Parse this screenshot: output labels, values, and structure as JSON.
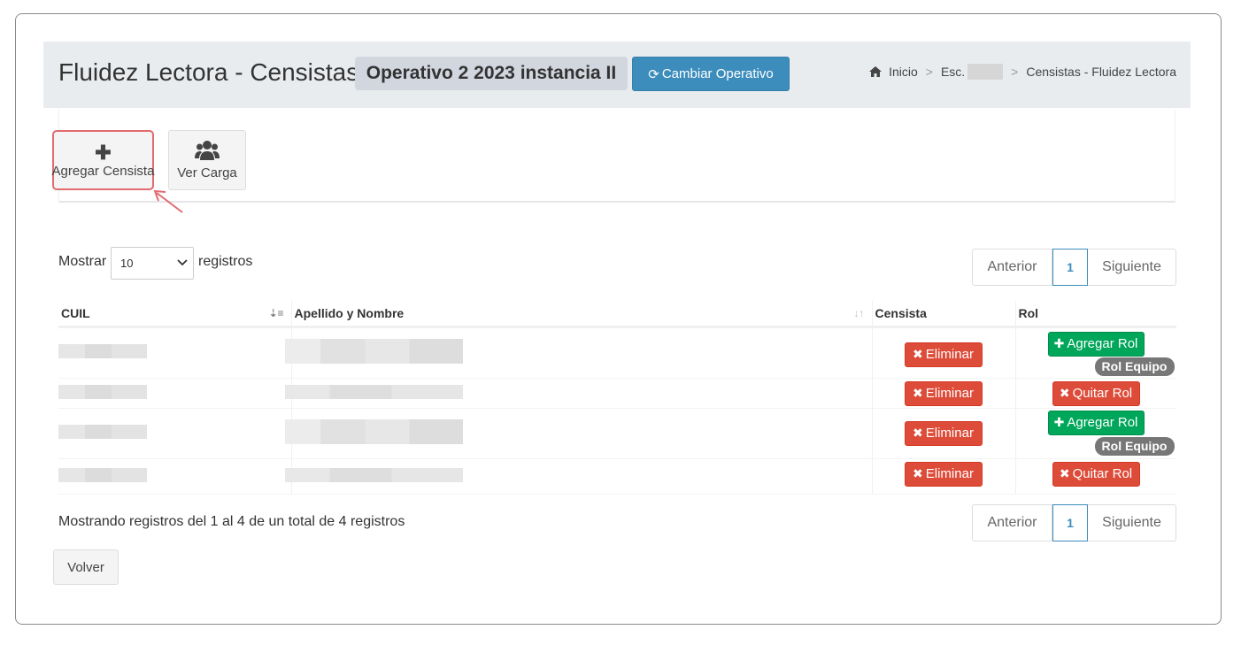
{
  "header": {
    "title": "Fluidez Lectora - Censistas",
    "operativo_badge": "Operativo 2 2023 instancia II",
    "cambiar_operativo_label": "Cambiar Operativo",
    "cambiar_icon": "refresh-icon"
  },
  "breadcrumb": {
    "home_icon": "home-icon",
    "items": [
      "Inicio",
      "Esc.",
      "Censistas - Fluidez Lectora"
    ],
    "separator": ">"
  },
  "toolbar": {
    "agregar_label": "Agregar Censista",
    "agregar_icon": "plus-icon",
    "ver_carga_label": "Ver Carga",
    "ver_carga_icon": "users-icon"
  },
  "table_controls": {
    "length_prefix": "Mostrar",
    "length_value": "10",
    "length_suffix": "registros"
  },
  "pagination": {
    "prev": "Anterior",
    "page": "1",
    "next": "Siguiente"
  },
  "table": {
    "columns": [
      "CUIL",
      "Apellido y Nombre",
      "Censista",
      "Rol"
    ],
    "rows": [
      {
        "eliminar": "Eliminar",
        "rol_action": "Agregar Rol",
        "rol_badge": "Rol Equipo"
      },
      {
        "eliminar": "Eliminar",
        "rol_action": "Quitar Rol"
      },
      {
        "eliminar": "Eliminar",
        "rol_action": "Agregar Rol",
        "rol_badge": "Rol Equipo"
      },
      {
        "eliminar": "Eliminar",
        "rol_action": "Quitar Rol"
      }
    ]
  },
  "footer": {
    "info": "Mostrando registros del 1 al 4 de un total de 4 registros",
    "volver_label": "Volver"
  },
  "colors": {
    "primary": "#3c8dbc",
    "danger": "#dd4b39",
    "success": "#00a65a",
    "badge_gray": "#777777",
    "header_bg": "#e9ecef",
    "highlight": "#e06b70"
  }
}
